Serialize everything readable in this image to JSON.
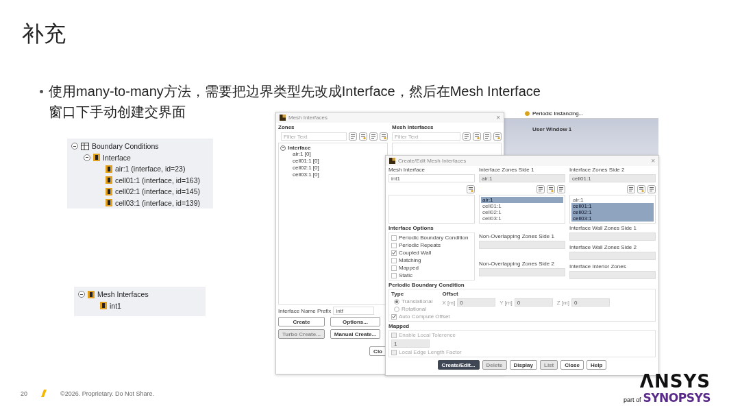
{
  "slide": {
    "title": "补充",
    "bullet_lines": [
      "使用many-to-many方法，需要把边界类型先改成Interface，然后在Mesh Interface",
      "窗口下手动创建交界面"
    ],
    "page_number": "20",
    "footer": "©2026. Proprietary. Do Not Share.",
    "logo": {
      "brand": "ΛNSYS",
      "part_of": "part of",
      "parent": "SYNOPSYS"
    }
  },
  "boundary_tree": {
    "label": "Boundary Conditions",
    "expanded": true,
    "children": [
      {
        "label": "Interface",
        "expanded": true,
        "children": [
          {
            "label": "air:1 (interface, id=23)"
          },
          {
            "label": "cell01:1 (interface, id=163)"
          },
          {
            "label": "cell02:1 (interface, id=145)"
          },
          {
            "label": "cell03:1 (interface, id=139)"
          }
        ]
      }
    ]
  },
  "mesh_tree": {
    "label": "Mesh Interfaces",
    "expanded": true,
    "children": [
      {
        "label": "int1"
      }
    ]
  },
  "background_window": {
    "toolbar_item": "Periodic Instancing...",
    "view_title": "User Window 1"
  },
  "mesh_interfaces_dialog": {
    "title": "Mesh Interfaces",
    "close_glyph": "×",
    "zones_label": "Zones",
    "zones_filter": {
      "placeholder": "Filter Text"
    },
    "zones_tree": {
      "label": "Interface",
      "expanded": true,
      "children": [
        {
          "label": "air:1  [0]"
        },
        {
          "label": "cell01:1  [0]"
        },
        {
          "label": "cell02:1  [0]"
        },
        {
          "label": "cell03:1  [0]"
        }
      ]
    },
    "interfaces_label": "Mesh Interfaces",
    "interfaces_filter": {
      "placeholder": "Filter Text"
    },
    "prefix_label": "Interface Name Prefix",
    "prefix_value": "intf",
    "buttons": [
      {
        "label": "Create",
        "disabled": false
      },
      {
        "label": "Options...",
        "disabled": false
      },
      {
        "label": "Turbo Create...",
        "disabled": true
      },
      {
        "label": "Manual Create...",
        "disabled": false
      }
    ],
    "close_button": "Clo"
  },
  "create_dialog": {
    "title": "Create/Edit Mesh Interfaces",
    "close_glyph": "×",
    "mesh_interface": {
      "label": "Mesh Interface",
      "value": "int1"
    },
    "side1": {
      "label": "Interface Zones Side 1",
      "value": "air:1",
      "items": [
        {
          "label": "air:1",
          "selected": true
        },
        {
          "label": "cell01:1",
          "selected": false
        },
        {
          "label": "cell02:1",
          "selected": false
        },
        {
          "label": "cell03:1",
          "selected": false
        }
      ]
    },
    "side2": {
      "label": "Interface Zones Side 2",
      "value": "cell01:1",
      "items": [
        {
          "label": "air:1",
          "selected": false
        },
        {
          "label": "cell01:1",
          "selected": true
        },
        {
          "label": "cell02:1",
          "selected": true
        },
        {
          "label": "cell03:1",
          "selected": true
        }
      ]
    },
    "options_label": "Interface Options",
    "options": [
      {
        "label": "Periodic Boundary Condition",
        "checked": false
      },
      {
        "label": "Periodic Repeats",
        "checked": false
      },
      {
        "label": "Coupled Wall",
        "checked": true
      },
      {
        "label": "Matching",
        "checked": false
      },
      {
        "label": "Mapped",
        "checked": false
      },
      {
        "label": "Static",
        "checked": false
      }
    ],
    "middle_fields": [
      "Non-Overlapping Zones Side 1",
      "Non-Overlapping Zones Side 2"
    ],
    "right_fields": [
      "Interface Wall Zones Side 1",
      "Interface Wall Zones Side 2",
      "Interface Interior Zones"
    ],
    "periodic": {
      "label": "Periodic Boundary Condition",
      "type_label": "Type",
      "types": [
        {
          "label": "Translational",
          "selected": true
        },
        {
          "label": "Rotational",
          "selected": false
        }
      ],
      "offset_label": "Offset",
      "offsets": [
        {
          "label": "X [m]",
          "value": "0"
        },
        {
          "label": "Y [m]",
          "value": "0"
        },
        {
          "label": "Z [m]",
          "value": "0"
        }
      ],
      "auto_compute": {
        "label": "Auto Compute Offset",
        "checked": true
      }
    },
    "mapped": {
      "label": "Mapped",
      "local_tolerance": {
        "label": "Enable Local Tolerence",
        "checked": false
      },
      "tolerance_value": "1",
      "edge_factor": {
        "label": "Local Edge Length Factor",
        "checked": false
      }
    },
    "buttons": [
      {
        "label": "Create/Edit...",
        "kind": "primary",
        "disabled": false
      },
      {
        "label": "Delete",
        "kind": "normal",
        "disabled": true
      },
      {
        "label": "Display",
        "kind": "normal",
        "disabled": false
      },
      {
        "label": "List",
        "kind": "normal",
        "disabled": true
      },
      {
        "label": "Close",
        "kind": "normal",
        "disabled": false
      },
      {
        "label": "Help",
        "kind": "normal",
        "disabled": false
      }
    ]
  }
}
